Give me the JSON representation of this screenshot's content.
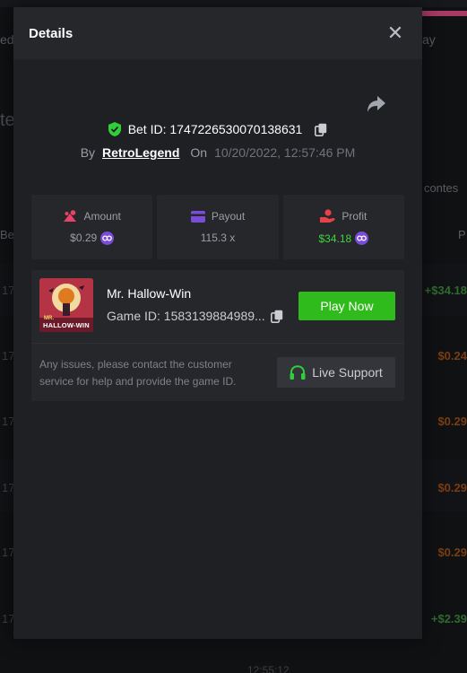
{
  "background": {
    "left_fragment_top": "ed",
    "right_fragment_top": "ay",
    "left_big": "te",
    "right_mid": "r contes",
    "left_be": "Be",
    "right_p": "P",
    "rows": [
      {
        "left": "17",
        "right": "+$34.18",
        "color": "green"
      },
      {
        "left": "17",
        "right": "$0.24",
        "color": "orange"
      },
      {
        "left": "17",
        "right": "$0.29",
        "color": "orange"
      },
      {
        "left": "17",
        "right": "$0.29",
        "color": "orange"
      },
      {
        "left": "17",
        "right": "$0.29",
        "color": "orange"
      },
      {
        "left": "17",
        "right": "+$2.39",
        "color": "green"
      }
    ],
    "bottom_time": "12:55:12"
  },
  "modal": {
    "title": "Details",
    "close_icon": "close-icon",
    "share_icon": "share-icon",
    "bet_id_label": "Bet ID: 1747226530070138631",
    "by_label": "By",
    "username": "RetroLegend",
    "on_label": "On",
    "datetime": "10/20/2022, 12:57:46 PM",
    "stats": [
      {
        "label": "Amount",
        "value": "$0.29",
        "icon": "bet-icon",
        "icon_color": "#e8416a"
      },
      {
        "label": "Payout",
        "value": "115.3 x",
        "icon": "card-icon",
        "icon_color": "#7a4cd8"
      },
      {
        "label": "Profit",
        "value": "$34.18",
        "icon": "hand-coin-icon",
        "icon_color": "#e8414a"
      }
    ],
    "game": {
      "name": "Mr. Hallow-Win",
      "id_label": "Game ID: 1583139884989...",
      "thumb_text_1": "MR.",
      "thumb_text_2": "HALLOW-WIN",
      "play_label": "Play Now"
    },
    "help_text": "Any issues, please contact the customer service for help and provide the game ID.",
    "live_support_label": "Live Support"
  },
  "colors": {
    "accent_green": "#30bb1c",
    "profit_green": "#3fd33f",
    "coin_purple": "#7a4cd8"
  }
}
